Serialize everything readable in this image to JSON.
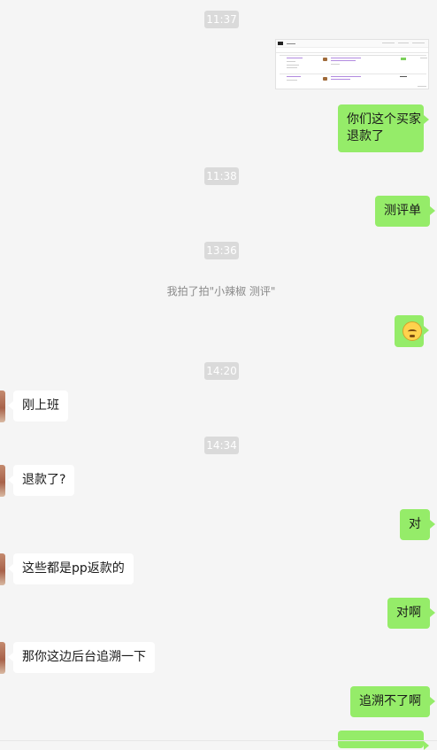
{
  "timestamps": [
    "11:37",
    "11:38",
    "13:36",
    "14:20",
    "14:34"
  ],
  "system_messages": {
    "pat": "我拍了拍\"小辣椒 测评\""
  },
  "messages": {
    "m1": "你们这个买家\n退款了",
    "m2": "测评单",
    "m3": "刚上班",
    "m4": "退款了?",
    "m5": "对",
    "m6": "这些都是pp返款的",
    "m7": "对啊",
    "m8": "那你这边后台追溯一下",
    "m9": "追溯不了啊"
  },
  "colors": {
    "background": "#f5f5f5",
    "outgoing_bubble": "#95ec69",
    "incoming_bubble": "#ffffff",
    "timestamp_pill": "#dadada"
  }
}
